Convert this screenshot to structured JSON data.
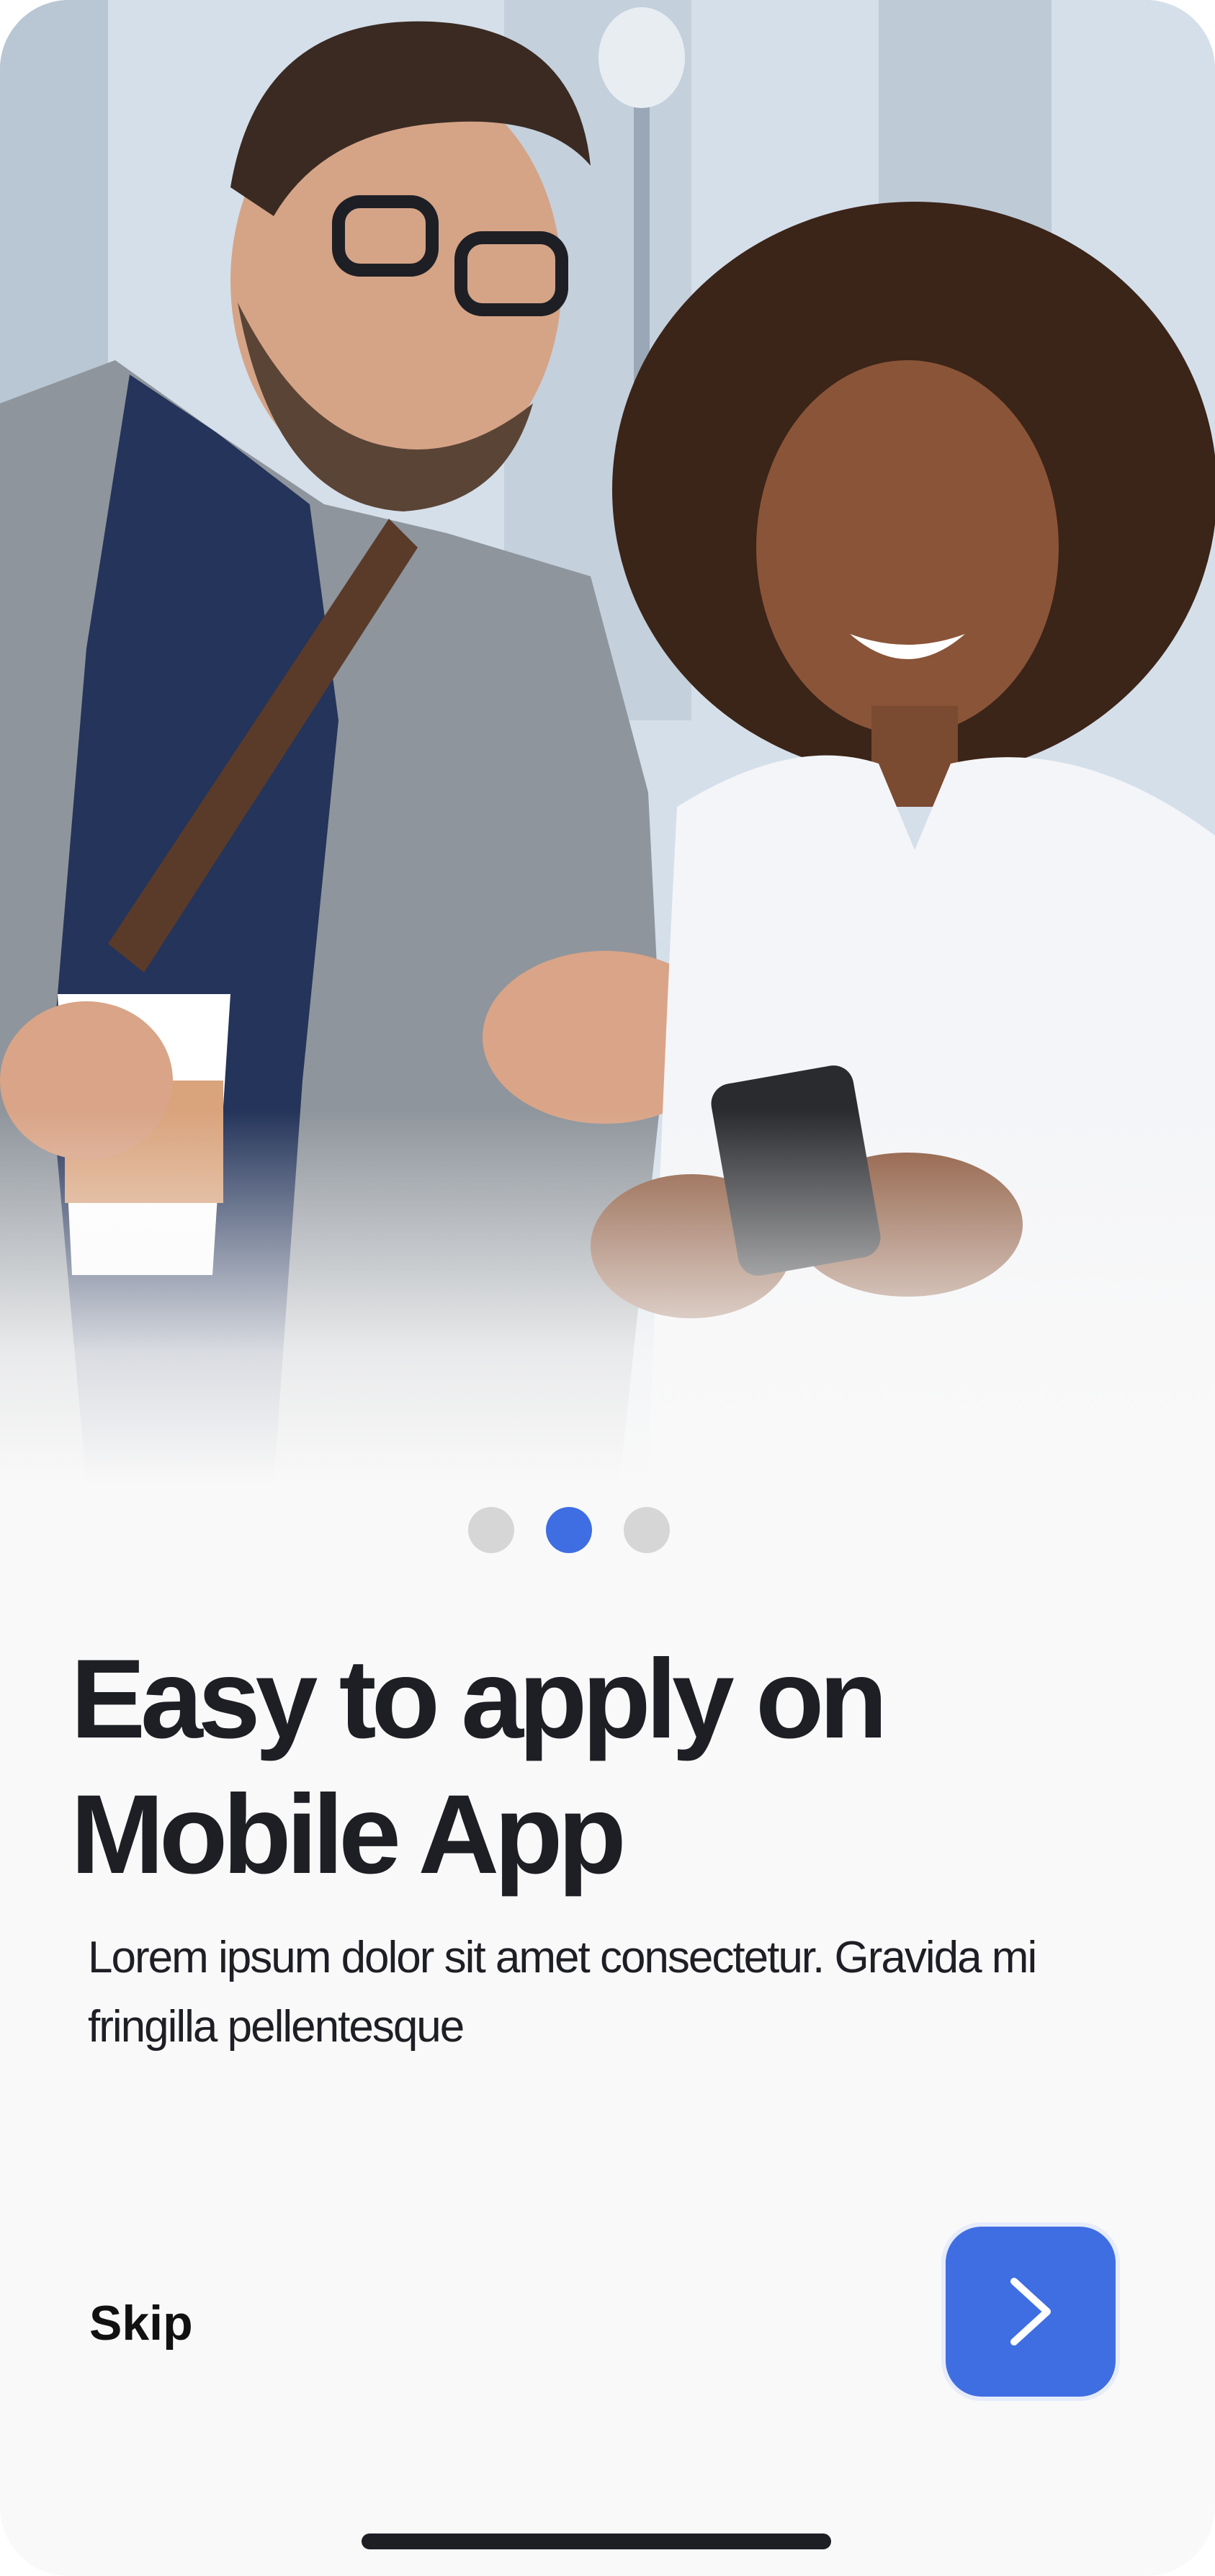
{
  "onboarding": {
    "pagination": {
      "total": 3,
      "active_index": 1
    },
    "title_lines": [
      "Easy to apply on",
      "Mobile App"
    ],
    "description": "Lorem ipsum dolor sit amet consectetur. Gravida mi fringilla pellentesque",
    "skip_label": "Skip",
    "next_icon": "chevron-right-icon"
  },
  "colors": {
    "accent": "#3f6ee3",
    "dot_inactive": "#d6d6d6",
    "text": "#1e1f25",
    "background": "#f9f9f9"
  }
}
